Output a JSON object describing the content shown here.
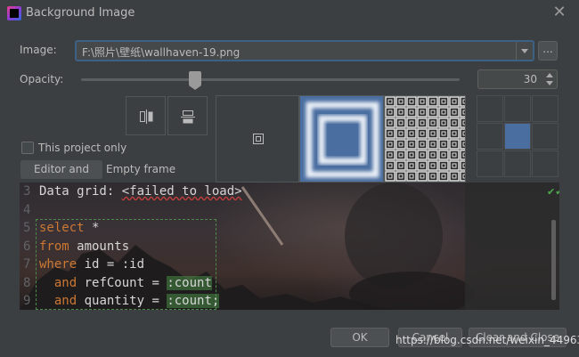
{
  "window": {
    "title": "Background Image"
  },
  "form": {
    "image_label": "Image:",
    "image_value": "F:\\照片\\壁纸\\wallhaven-19.png",
    "browse_label": "...",
    "opacity_label": "Opacity:",
    "opacity_value": "30",
    "opacity_fraction": 0.3,
    "this_project_only": "This project only"
  },
  "tabs": {
    "editor_and_tools": "Editor and tools",
    "empty_frame": "Empty frame"
  },
  "preview": {
    "lines": [
      {
        "num": "3",
        "parts": [
          {
            "t": "Data grid: ",
            "c": "tx"
          },
          {
            "t": "<failed to load>",
            "c": "err"
          }
        ]
      },
      {
        "num": "4",
        "parts": []
      },
      {
        "num": "5",
        "parts": [
          {
            "t": "select",
            "c": "kw"
          },
          {
            "t": " *",
            "c": "tx"
          }
        ]
      },
      {
        "num": "6",
        "parts": [
          {
            "t": "from",
            "c": "kw"
          },
          {
            "t": " amounts",
            "c": "tx"
          }
        ]
      },
      {
        "num": "7",
        "parts": [
          {
            "t": "where",
            "c": "kw"
          },
          {
            "t": " id = :id",
            "c": "tx"
          }
        ]
      },
      {
        "num": "8",
        "parts": [
          {
            "t": "  and",
            "c": "kw"
          },
          {
            "t": " refCount = ",
            "c": "tx"
          },
          {
            "t": ":count",
            "c": "tx tint"
          }
        ]
      },
      {
        "num": "9",
        "parts": [
          {
            "t": "  and",
            "c": "kw"
          },
          {
            "t": " quantity = ",
            "c": "tx"
          },
          {
            "t": ":count;",
            "c": "tx tint"
          }
        ]
      }
    ]
  },
  "buttons": {
    "ok": "OK",
    "cancel": "Cancel",
    "clear_and_close": "Clear and Close"
  },
  "watermark": "https://blog.csdn.net/weixin_44963395",
  "colors": {
    "accent_border": "#3d6185",
    "selected_tile": "#4a6ea0",
    "background": "#3c3f41"
  }
}
